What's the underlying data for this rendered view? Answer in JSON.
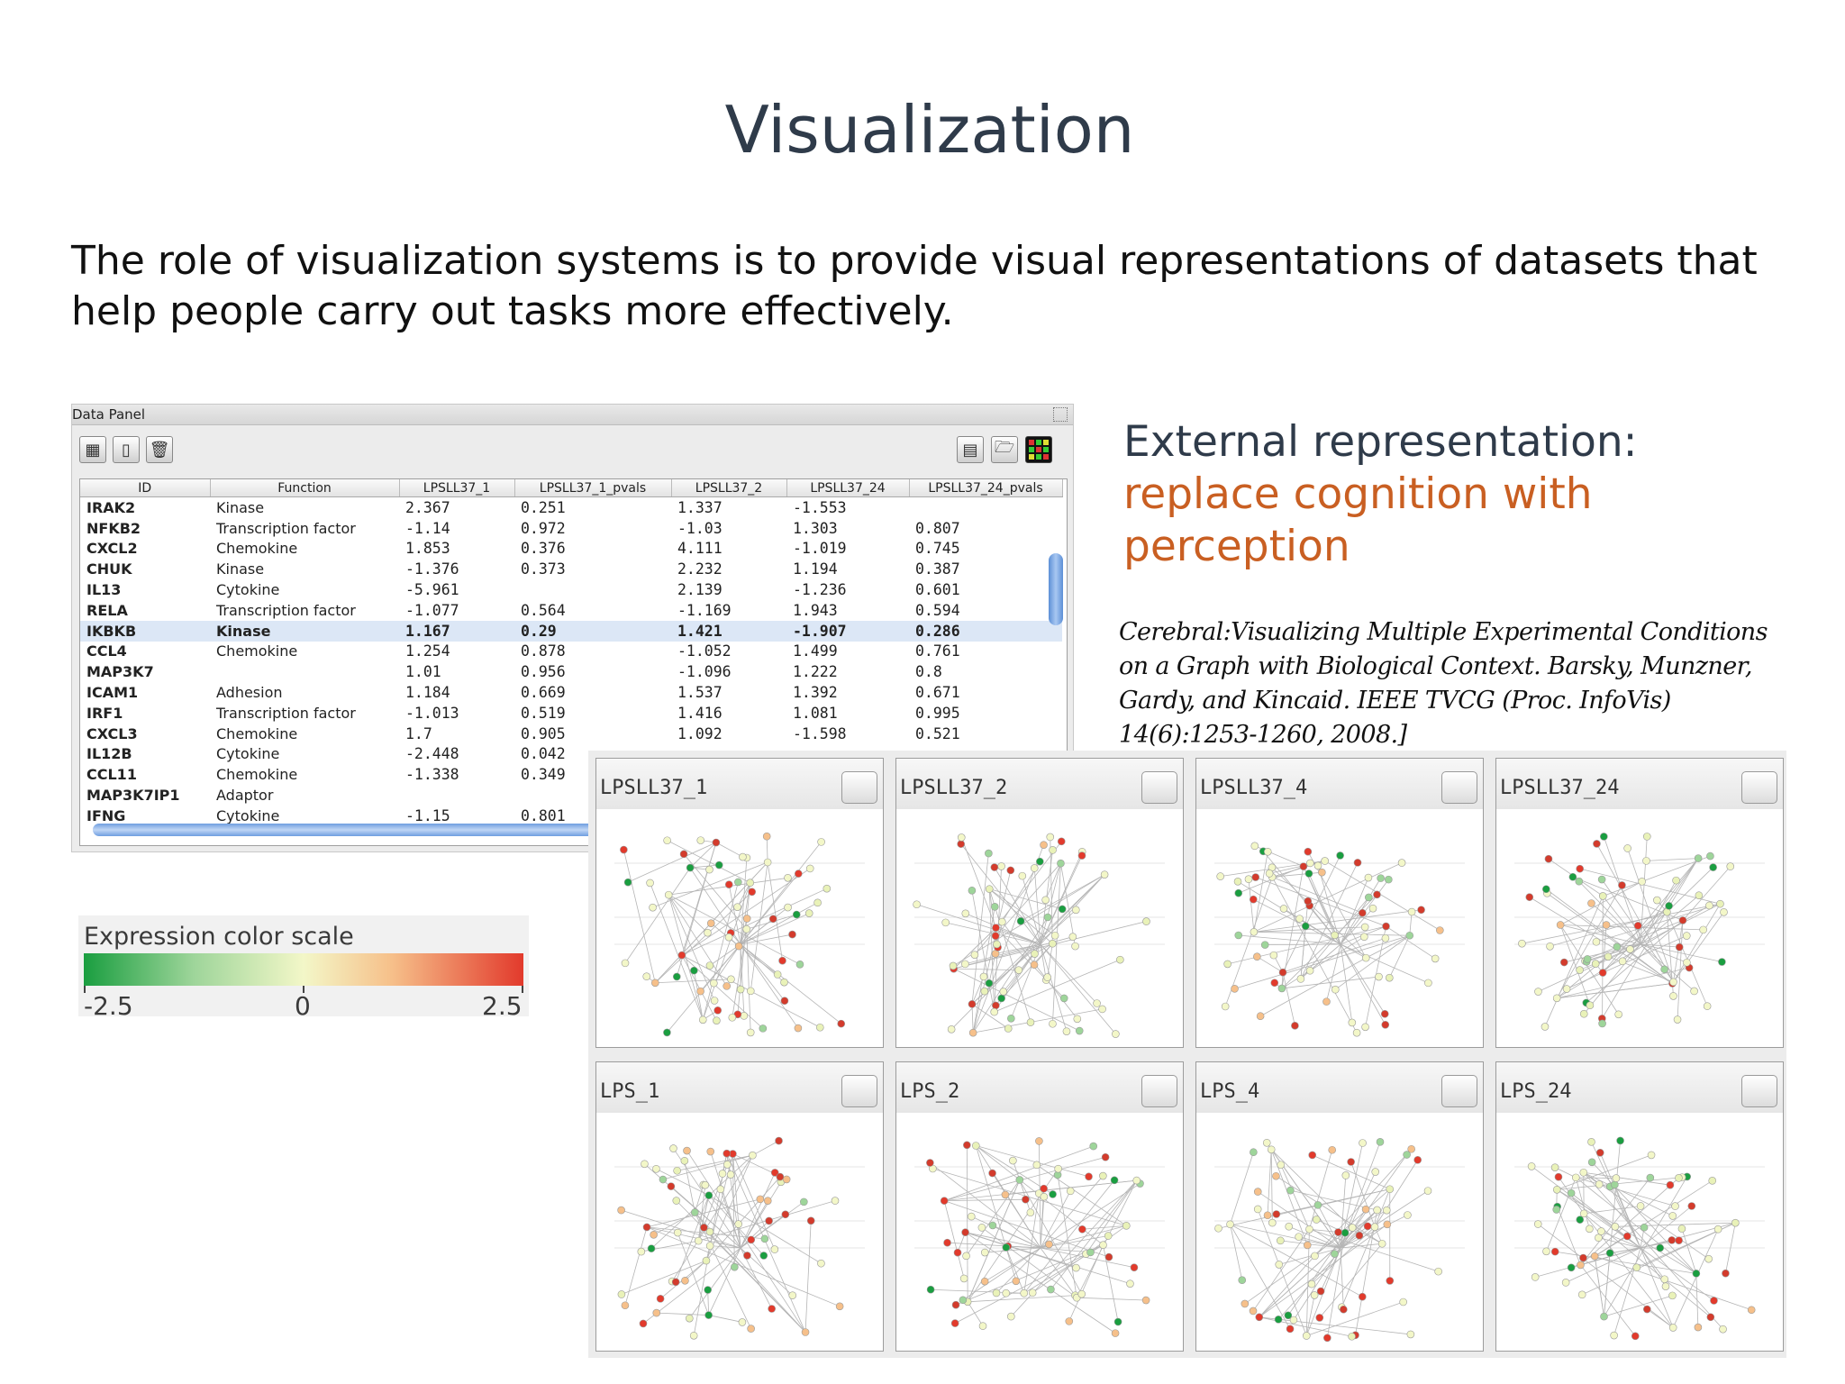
{
  "slide": {
    "title": "Visualization",
    "subtitle": "The role of visualization systems is to provide visual representations of datasets that help people carry out tasks more effectively."
  },
  "data_panel": {
    "title": "Data Panel",
    "toolbar_icons": [
      "table-icon",
      "document-icon",
      "trash-icon",
      "spreadsheet-icon",
      "folder-open-icon",
      "heatmap-icon"
    ],
    "columns": [
      "ID",
      "Function",
      "LPSLL37_1",
      "LPSLL37_1_pvals",
      "LPSLL37_2",
      "LPSLL37_24",
      "LPSLL37_24_pvals"
    ],
    "rows": [
      [
        "IRAK2",
        "Kinase",
        "2.367",
        "0.251",
        "1.337",
        "-1.553",
        ""
      ],
      [
        "NFKB2",
        "Transcription factor",
        "-1.14",
        "0.972",
        "-1.03",
        "1.303",
        "0.807"
      ],
      [
        "CXCL2",
        "Chemokine",
        "1.853",
        "0.376",
        "4.111",
        "-1.019",
        "0.745"
      ],
      [
        "CHUK",
        "Kinase",
        "-1.376",
        "0.373",
        "2.232",
        "1.194",
        "0.387"
      ],
      [
        "IL13",
        "Cytokine",
        "-5.961",
        "",
        "2.139",
        "-1.236",
        "0.601"
      ],
      [
        "RELA",
        "Transcription factor",
        "-1.077",
        "0.564",
        "-1.169",
        "1.943",
        "0.594"
      ],
      [
        "IKBKB",
        "Kinase",
        "1.167",
        "0.29",
        "1.421",
        "-1.907",
        "0.286"
      ],
      [
        "CCL4",
        "Chemokine",
        "1.254",
        "0.878",
        "-1.052",
        "1.499",
        "0.761"
      ],
      [
        "MAP3K7",
        "",
        "1.01",
        "0.956",
        "-1.096",
        "1.222",
        "0.8"
      ],
      [
        "ICAM1",
        "Adhesion",
        "1.184",
        "0.669",
        "1.537",
        "1.392",
        "0.671"
      ],
      [
        "IRF1",
        "Transcription factor",
        "-1.013",
        "0.519",
        "1.416",
        "1.081",
        "0.995"
      ],
      [
        "CXCL3",
        "Chemokine",
        "1.7",
        "0.905",
        "1.092",
        "-1.598",
        "0.521"
      ],
      [
        "IL12B",
        "Cytokine",
        "-2.448",
        "0.042",
        "",
        "",
        ""
      ],
      [
        "CCL11",
        "Chemokine",
        "-1.338",
        "0.349",
        "",
        "",
        ""
      ],
      [
        "MAP3K7IP1",
        "Adaptor",
        "",
        "",
        "",
        "",
        ""
      ],
      [
        "IFNG",
        "Cytokine",
        "-1.15",
        "0.801",
        "",
        "",
        ""
      ]
    ],
    "selected_row": 6
  },
  "external": {
    "heading": "External representation",
    "colon": ":",
    "accent": "replace cognition with perception",
    "accent_color": "#c95f22"
  },
  "citation": "Cerebral:Visualizing Multiple Experimental Conditions on a Graph with Biological Context. Barsky, Munzner, Gardy, and Kincaid. IEEE TVCG (Proc. InfoVis) 14(6):1253-1260, 2008.]",
  "color_scale": {
    "title": "Expression color scale",
    "min": "-2.5",
    "mid": "0",
    "max": "2.5",
    "low_color": "#1a9e40",
    "mid_color": "#f3f7c8",
    "high_color": "#e23a2c"
  },
  "network_panels": [
    {
      "title": "LPSLL37_1"
    },
    {
      "title": "LPSLL37_2"
    },
    {
      "title": "LPSLL37_4"
    },
    {
      "title": "LPSLL37_24"
    },
    {
      "title": "LPS_1"
    },
    {
      "title": "LPS_2"
    },
    {
      "title": "LPS_4"
    },
    {
      "title": "LPS_24"
    }
  ]
}
